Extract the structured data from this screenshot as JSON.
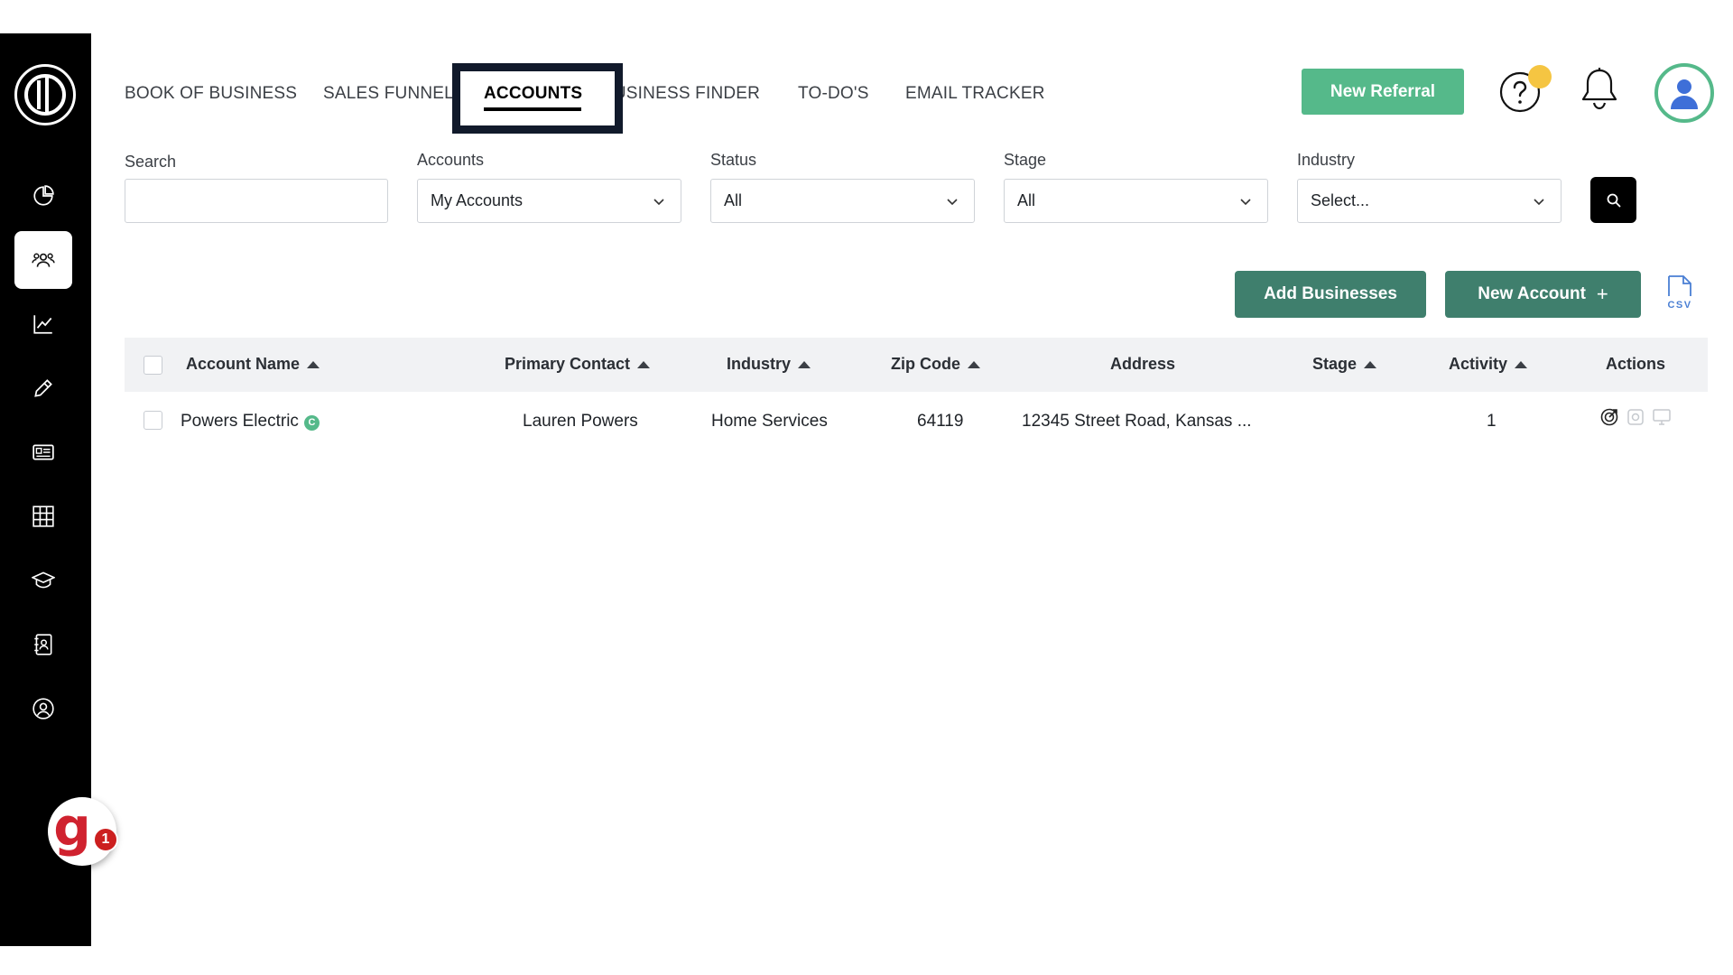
{
  "nav": {
    "items": [
      "BOOK OF BUSINESS",
      "SALES FUNNEL",
      "BUSINESS FINDER",
      "TO-DO'S",
      "EMAIL TRACKER"
    ],
    "active": "ACCOUNTS"
  },
  "header": {
    "new_referral": "New Referral"
  },
  "sidebar": {
    "icons": [
      "pie-chart-icon",
      "users-icon",
      "trend-line-icon",
      "pencil-icon",
      "newspaper-icon",
      "grid-icon",
      "graduation-cap-icon",
      "contact-book-icon",
      "user-circle-icon"
    ],
    "badge_letter": "g.",
    "badge_count": "1"
  },
  "filters": {
    "search": {
      "label": "Search",
      "value": ""
    },
    "accounts": {
      "label": "Accounts",
      "value": "My Accounts"
    },
    "status": {
      "label": "Status",
      "value": "All"
    },
    "stage": {
      "label": "Stage",
      "value": "All"
    },
    "industry": {
      "label": "Industry",
      "value": "Select..."
    }
  },
  "actions": {
    "add_businesses": "Add Businesses",
    "new_account": "New Account",
    "new_account_icon": "+",
    "csv_label": "CSV"
  },
  "table": {
    "columns": [
      "Account Name",
      "Primary Contact",
      "Industry",
      "Zip Code",
      "Address",
      "Stage",
      "Activity",
      "Actions"
    ],
    "rows": [
      {
        "account_name": "Powers Electric",
        "badge": "C",
        "primary_contact": "Lauren Powers",
        "industry": "Home Services",
        "zip_code": "64119",
        "address": "12345 Street Road, Kansas ...",
        "stage": "",
        "activity": "1"
      }
    ]
  },
  "colors": {
    "sidebar": "#000000",
    "primary_green": "#55b98a",
    "dark_green": "#3f7f6d",
    "help_dot": "#f5c542",
    "badge_red": "#d0222f"
  }
}
